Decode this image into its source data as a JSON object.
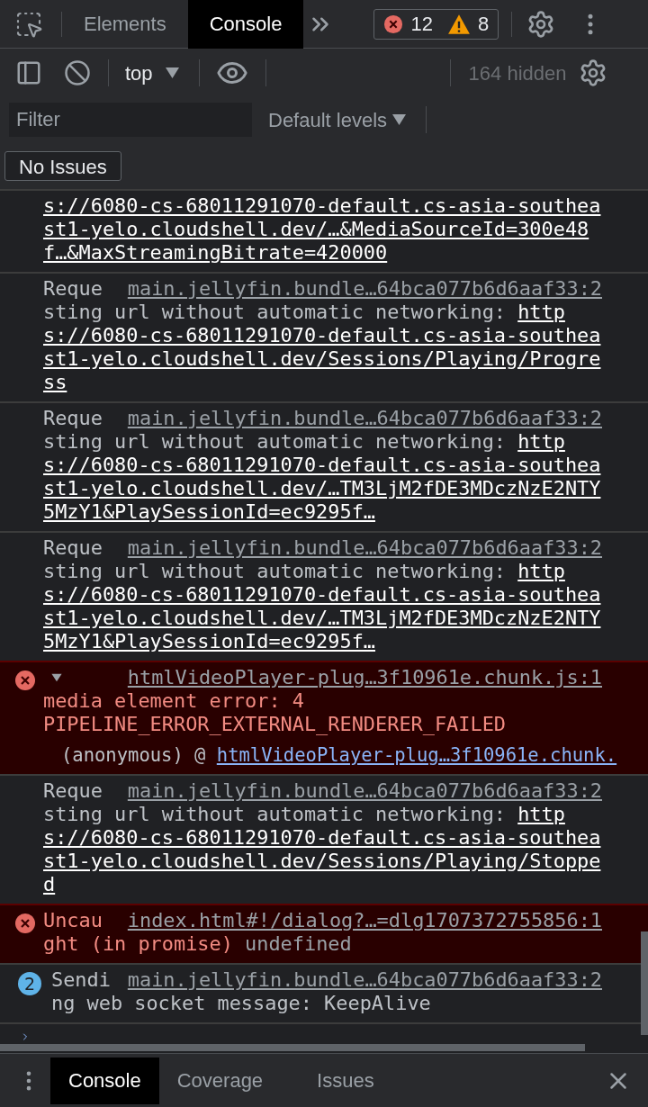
{
  "toolbar": {
    "tabs": [
      {
        "label": "Elements",
        "selected": false
      },
      {
        "label": "Console",
        "selected": true
      }
    ],
    "errors": "12",
    "warnings": "8"
  },
  "console_toolbar": {
    "context": "top",
    "hidden": "164 hidden"
  },
  "filter": {
    "placeholder": "Filter",
    "levels": "Default levels"
  },
  "issues_button": "No Issues",
  "messages": [
    {
      "kind": "log",
      "lines": [
        {
          "url": "s://6080-cs-68011291070-default.cs-asia-southea"
        },
        {
          "url": "st1-yelo.cloudshell.dev/…&MediaSourceId=300e48"
        },
        {
          "url": "f…&MaxStreamingBitrate=420000"
        }
      ]
    },
    {
      "kind": "log",
      "source": "main.jellyfin.bundle…64bca077b6d6aaf33:2",
      "lines": [
        {
          "text": "Reque"
        },
        {
          "text": "sting url without automatic networking: ",
          "url": "http"
        },
        {
          "url": "s://6080-cs-68011291070-default.cs-asia-southea"
        },
        {
          "url": "st1-yelo.cloudshell.dev/Sessions/Playing/Progre"
        },
        {
          "url": "ss"
        }
      ]
    },
    {
      "kind": "log",
      "source": "main.jellyfin.bundle…64bca077b6d6aaf33:2",
      "lines": [
        {
          "text": "Reque"
        },
        {
          "text": "sting url without automatic networking: ",
          "url": "http"
        },
        {
          "url": "s://6080-cs-68011291070-default.cs-asia-southea"
        },
        {
          "url": "st1-yelo.cloudshell.dev/…TM3LjM2fDE3MDczNzE2NTY"
        },
        {
          "url": "5MzY1&PlaySessionId=ec9295f…"
        }
      ]
    },
    {
      "kind": "log",
      "source": "main.jellyfin.bundle…64bca077b6d6aaf33:2",
      "lines": [
        {
          "text": "Reque"
        },
        {
          "text": "sting url without automatic networking: ",
          "url": "http"
        },
        {
          "url": "s://6080-cs-68011291070-default.cs-asia-southea"
        },
        {
          "url": "st1-yelo.cloudshell.dev/…TM3LjM2fDE3MDczNzE2NTY"
        },
        {
          "url": "5MzY1&PlaySessionId=ec9295f…"
        }
      ]
    },
    {
      "kind": "error",
      "expanded": true,
      "source": "htmlVideoPlayer-plug…3f10961e.chunk.js:1",
      "lines": [
        {
          "text": "media element error: 4"
        },
        {
          "text": "PIPELINE_ERROR_EXTERNAL_RENDERER_FAILED"
        }
      ],
      "stack": {
        "frame": "(anonymous) @ ",
        "link": "htmlVideoPlayer-plug…3f10961e.chunk."
      }
    },
    {
      "kind": "log",
      "source": "main.jellyfin.bundle…64bca077b6d6aaf33:2",
      "lines": [
        {
          "text": "Reque"
        },
        {
          "text": "sting url without automatic networking: ",
          "url": "http"
        },
        {
          "url": "s://6080-cs-68011291070-default.cs-asia-southea"
        },
        {
          "url": "st1-yelo.cloudshell.dev/Sessions/Playing/Stoppe"
        },
        {
          "url": "d"
        }
      ]
    },
    {
      "kind": "error",
      "source": "index.html#!/dialog?…=dlg1707372755856:1",
      "lines": [
        {
          "text": "Uncau"
        },
        {
          "text": "ght (in promise)",
          "value": " undefined"
        }
      ]
    },
    {
      "kind": "log",
      "count": "2",
      "source": "main.jellyfin.bundle…64bca077b6d6aaf33:2",
      "lines": [
        {
          "text": "Sendi"
        },
        {
          "text": "ng web socket message: KeepAlive"
        }
      ]
    }
  ],
  "drawer": {
    "tabs": [
      {
        "label": "Console",
        "selected": true
      },
      {
        "label": "Coverage",
        "selected": false
      },
      {
        "label": "Issues",
        "selected": false
      }
    ]
  }
}
